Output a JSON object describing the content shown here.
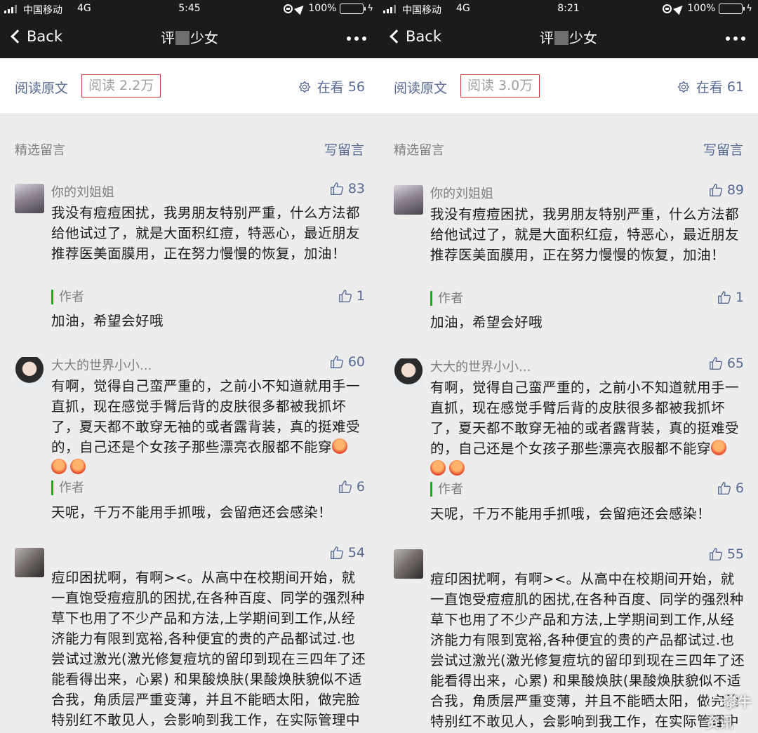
{
  "colors": {
    "link": "#576b95",
    "topbar": "#1b1b1b",
    "author_bar": "#1aad19",
    "highlight_box": "#c83a3a"
  },
  "panels": [
    {
      "status": {
        "carrier": "中国移动",
        "network": "4G",
        "time": "5:45",
        "battery": "100%"
      },
      "nav": {
        "back_label": "Back",
        "title_before": "评",
        "title_after": "少女"
      },
      "readbar": {
        "read_original": "阅读原文",
        "read_count": "阅读 2.2万",
        "looking_label": "在看",
        "looking_count": "56"
      },
      "section": {
        "title": "精选留言",
        "write": "写留言"
      },
      "comments": [
        {
          "nick": "你的刘姐姐",
          "likes": "83",
          "body": "我没有痘痘困扰，我男朋友特别严重，什么方法都给他试过了，就是大面积红痘，特恶心，最近朋友推荐医美面膜用，正在努力慢慢的恢复，加油！",
          "author_label": "作者",
          "author_likes": "1",
          "reply": "加油，希望会好哦"
        },
        {
          "nick": "大大的世界小小...",
          "likes": "60",
          "body": "有啊，觉得自己蛮严重的，之前小不知道就用手一直抓，现在感觉手臂后背的皮肤很多都被我抓坏了，夏天都不敢穿无袖的或者露背装，真的挺难受的，自己还是个女孩子那些漂亮衣服都不能穿",
          "author_label": "作者",
          "author_likes": "6",
          "reply": "天呢，千万不能用手抓哦，会留疤还会感染！"
        },
        {
          "nick": "",
          "likes": "54",
          "body": "痘印困扰啊，有啊><。从高中在校期间开始，就一直饱受痘痘肌的困扰,在各种百度、同学的强烈种草下也用了不少产品和方法,上学期间到工作,从经济能力有限到宽裕,各种便宜的贵的产品都试过.也尝试过激光(激光修复痘坑的留印到现在三四年了还能看得出来，心累) 和果酸焕肤(果酸焕肤貌似不适合我，角质层严重变薄，并且不能晒太阳，做完脸特别红不敢见人，会影响到我工作，在实际管理中心做库存，给机也"
        }
      ]
    },
    {
      "status": {
        "carrier": "中国移动",
        "network": "4G",
        "time": "8:21",
        "battery": "100%"
      },
      "nav": {
        "back_label": "Back",
        "title_before": "评",
        "title_after": "少女"
      },
      "readbar": {
        "read_original": "阅读原文",
        "read_count": "阅读 3.0万",
        "looking_label": "在看",
        "looking_count": "61"
      },
      "section": {
        "title": "精选留言",
        "write": "写留言"
      },
      "comments": [
        {
          "nick": "你的刘姐姐",
          "likes": "89",
          "body": "我没有痘痘困扰，我男朋友特别严重，什么方法都给他试过了，就是大面积红痘，特恶心，最近朋友推荐医美面膜用，正在努力慢慢的恢复，加油！",
          "author_label": "作者",
          "author_likes": "1",
          "reply": "加油，希望会好哦"
        },
        {
          "nick": "大大的世界小小...",
          "likes": "65",
          "body": "有啊，觉得自己蛮严重的，之前小不知道就用手一直抓，现在感觉手臂后背的皮肤很多都被我抓坏了，夏天都不敢穿无袖的或者露背装，真的挺难受的，自己还是个女孩子那些漂亮衣服都不能穿",
          "author_label": "作者",
          "author_likes": "6",
          "reply": "天呢，千万不能用手抓哦，会留疤还会感染！"
        },
        {
          "nick": "",
          "likes": "55",
          "body": "痘印困扰啊，有啊><。从高中在校期间开始，就一直饱受痘痘肌的困扰,在各种百度、同学的强烈种草下也用了不少产品和方法,上学期间到工作,从经济能力有限到宽裕,各种便宜的贵的产品都试过.也尝试过激光(激光修复痘坑的留印到现在三四年了还能看得出来，心累) 和果酸焕肤(果酸焕肤貌似不适合我，角质层严重变薄，并且不能晒太阳，做完脸特别红不敢见人，会影响到我工作，在实际管理中心做库存，给机也"
        }
      ]
    }
  ],
  "watermark": "攀牛资讯"
}
